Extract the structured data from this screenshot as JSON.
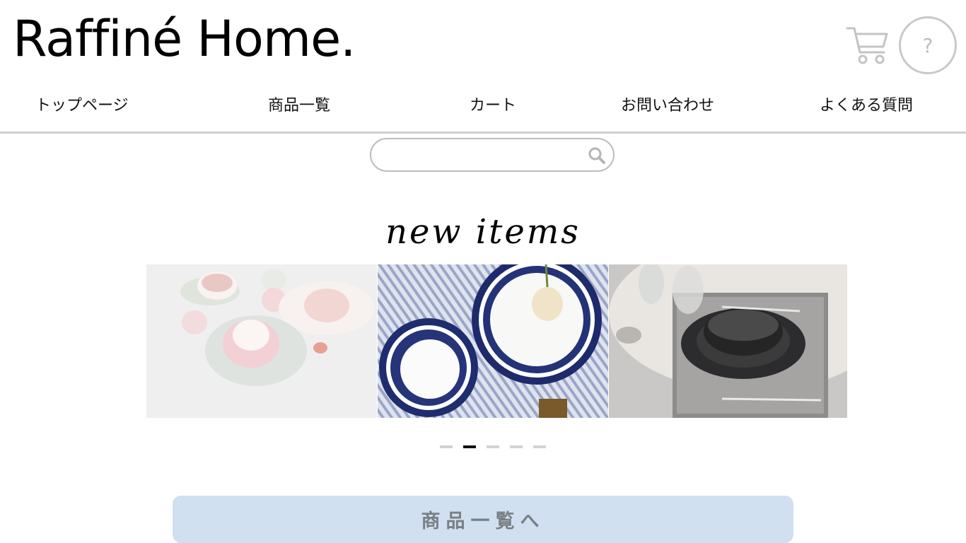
{
  "header": {
    "logo": "Raffiné Home.",
    "cart_icon": "cart-icon",
    "help_icon": "question-circle-icon",
    "help_label": "?"
  },
  "nav": {
    "items": [
      {
        "label": "トップページ"
      },
      {
        "label": "商品一覧"
      },
      {
        "label": "カート"
      },
      {
        "label": "お問い合わせ"
      },
      {
        "label": "よくある質問"
      }
    ]
  },
  "search": {
    "placeholder": "",
    "icon": "search-icon"
  },
  "main": {
    "section_title": "new items",
    "carousel": {
      "slides": [
        "product-photo-pastel-tableware",
        "product-photo-blue-pattern-plates",
        "product-photo-black-dinnerware"
      ],
      "dot_count": 5,
      "active_dot": 2
    },
    "cta_label": "商品一覧へ"
  },
  "colors": {
    "cta_background": "#d0e0f0",
    "cta_text": "#7a7f86",
    "icon_gray": "#c9c9c9",
    "nav_line": "#cfcfcf"
  }
}
